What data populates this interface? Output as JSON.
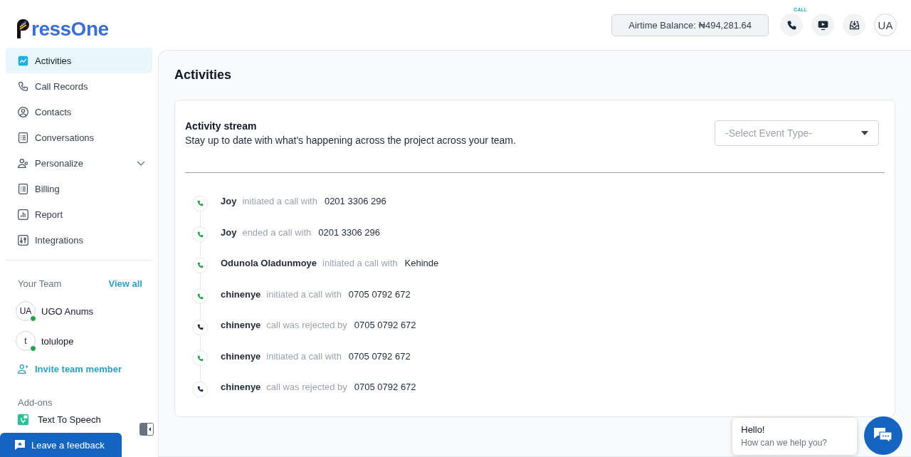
{
  "logo": {
    "text": "ressOne"
  },
  "sidebar": {
    "items": [
      {
        "label": "Activities",
        "selected": true
      },
      {
        "label": "Call Records",
        "selected": false
      },
      {
        "label": "Contacts",
        "selected": false
      },
      {
        "label": "Conversations",
        "selected": false
      },
      {
        "label": "Personalize",
        "selected": false,
        "expanded": false
      },
      {
        "label": "Billing",
        "selected": false
      },
      {
        "label": "Report",
        "selected": false
      },
      {
        "label": "Integrations",
        "selected": false
      }
    ],
    "team": {
      "title": "Your Team",
      "view_all": "View all",
      "members": [
        {
          "initials": "UA",
          "name": "UGO Anums",
          "online": true
        },
        {
          "initials": "t",
          "name": "tolulope",
          "online": true
        }
      ],
      "invite": "Invite team member"
    },
    "addons": {
      "title": "Add-ons",
      "items": [
        {
          "label": "Text To Speech"
        }
      ]
    }
  },
  "feedback_button": "Leave a feedback",
  "header": {
    "balance": "Airtime Balance: ₦494,281.64",
    "call_badge": "CALL",
    "avatar": "UA"
  },
  "page": {
    "title": "Activities",
    "stream": {
      "title": "Activity stream",
      "subtitle": "Stay up to date with what's happening across the project across your team.",
      "filter": {
        "placeholder": "-Select Event Type-"
      },
      "events": [
        {
          "kind": "connected",
          "actor": "Joy",
          "action": "initiated a call with",
          "target": "0201 3306 296"
        },
        {
          "kind": "connected",
          "actor": "Joy",
          "action": "ended a call with",
          "target": "0201 3306 296"
        },
        {
          "kind": "connected",
          "actor": "Odunola Oladunmoye",
          "action": "initiated a call with",
          "target": "Kehinde"
        },
        {
          "kind": "connected",
          "actor": "chinenye",
          "action": "initiated a call with",
          "target": "0705 0792 672"
        },
        {
          "kind": "rejected",
          "actor": "chinenye",
          "action": "call was rejected by",
          "target": "0705 0792 672"
        },
        {
          "kind": "connected",
          "actor": "chinenye",
          "action": "initiated a call with",
          "target": "0705 0792 672"
        },
        {
          "kind": "rejected",
          "actor": "chinenye",
          "action": "call was rejected by",
          "target": "0705 0792 672"
        }
      ]
    }
  },
  "chat_widget": {
    "greeting": "Hello!",
    "prompt": "How can we help you?"
  }
}
